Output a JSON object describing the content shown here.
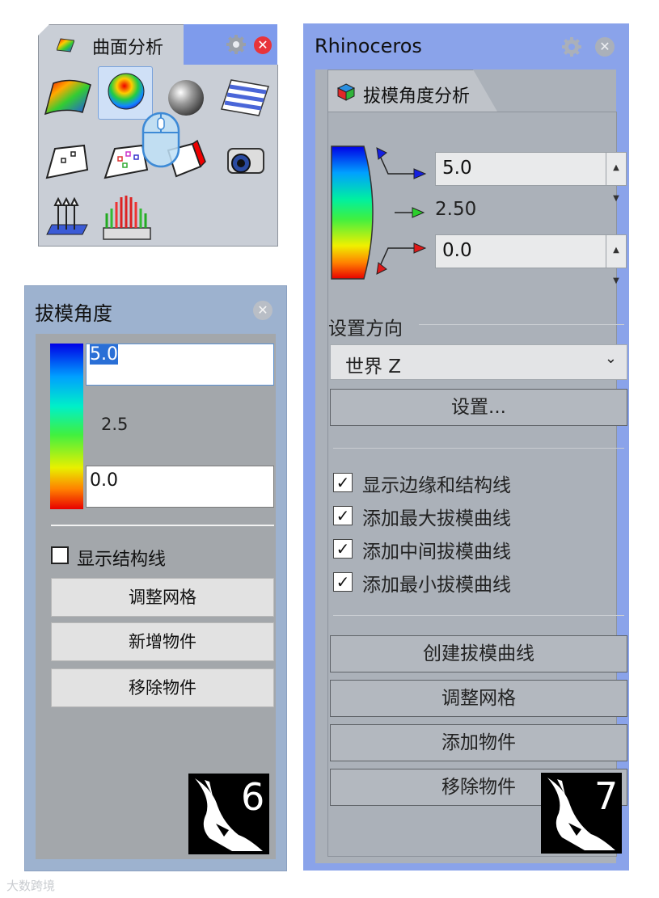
{
  "toolbar": {
    "tab_label": "曲面分析",
    "icons": [
      "zebra-surface-icon",
      "curvature-sphere-icon",
      "environment-map-icon",
      "zebra-stripes-icon",
      "point-deviation-icon",
      "control-points-icon",
      "edge-analysis-icon",
      "camera-icon",
      "normal-direction-icon",
      "thickness-analysis-icon"
    ]
  },
  "r6": {
    "title": "拔模角度",
    "max_value": "5.0",
    "mid_value": "2.5",
    "min_value": "0.0",
    "show_structure_label": "显示结构线",
    "show_structure_checked": false,
    "btn_adjust_mesh": "调整网格",
    "btn_add_object": "新增物件",
    "btn_remove_object": "移除物件",
    "logo_number": "6"
  },
  "r7": {
    "title": "Rhinoceros",
    "tab_label": "拔模角度分析",
    "max_value": "5.0",
    "mid_value": "2.50",
    "min_value": "0.0",
    "direction_label": "设置方向",
    "direction_value": "世界 Z",
    "set_button": "设置...",
    "checkboxes": [
      {
        "label": "显示边缘和结构线",
        "checked": true
      },
      {
        "label": "添加最大拔模曲线",
        "checked": true
      },
      {
        "label": "添加中间拔模曲线",
        "checked": true
      },
      {
        "label": "添加最小拔模曲线",
        "checked": true
      }
    ],
    "btn_create_curve": "创建拔模曲线",
    "btn_adjust_mesh": "调整网格",
    "btn_add_object": "添加物件",
    "btn_remove_object": "移除物件",
    "logo_number": "7"
  },
  "watermark": "大数跨境",
  "colors": {
    "accent_blue": "#7e9bec",
    "selection": "#2a6fd6",
    "close_red": "#e8343b"
  }
}
